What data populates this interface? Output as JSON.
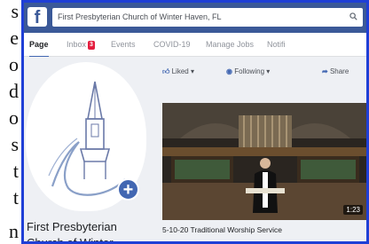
{
  "side_text": {
    "lines": [
      "s",
      "e",
      "o",
      "d",
      "o",
      "s",
      "t",
      "t",
      "n"
    ]
  },
  "topbar": {
    "search_value": "First Presbyterian Church of Winter Haven, FL"
  },
  "tabs": [
    {
      "label": "Page"
    },
    {
      "label": "Inbox",
      "badge": "3"
    },
    {
      "label": "Events"
    },
    {
      "label": "COVID-19"
    },
    {
      "label": "Manage Jobs"
    },
    {
      "label": "Notifi"
    }
  ],
  "profile": {
    "name_line1": "First Presbyterian",
    "name_line2": "Church of Winter"
  },
  "actions": {
    "liked": "Liked ▾",
    "following": "Following ▾",
    "share": "Share"
  },
  "video": {
    "duration": "1:23",
    "title": "5-10-20 Traditional Worship Service"
  },
  "colors": {
    "brand": "#3b5998",
    "frame_border": "#1f3fd6",
    "badge": "#e41e3f"
  }
}
